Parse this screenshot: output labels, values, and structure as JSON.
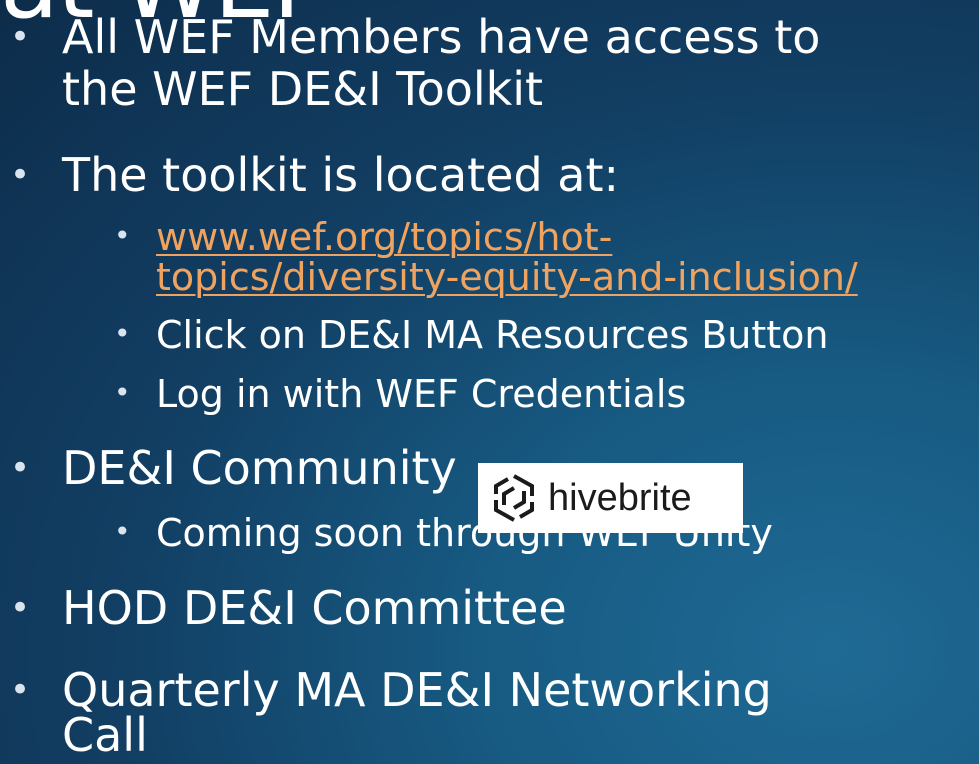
{
  "title_fragment": "at WEF",
  "bullets": [
    {
      "id": "members",
      "lines": [
        "All WEF Members have access to",
        "the WEF DE&I Toolkit"
      ]
    },
    {
      "id": "toolkit",
      "lines": [
        "The toolkit is located at:"
      ]
    },
    {
      "id": "community",
      "lines": [
        "DE&I Community"
      ]
    },
    {
      "id": "hod",
      "lines": [
        "HOD DE&I Committee"
      ]
    },
    {
      "id": "networking",
      "lines": [
        "Quarterly MA DE&I Networking",
        "Call"
      ]
    }
  ],
  "toolkit_subitems": {
    "link_line1": "www.wef.org/topics/hot-",
    "link_line2": "topics/diversity-equity-and-inclusion/",
    "click": "Click on DE&I MA Resources Button",
    "login": "Log in with WEF Credentials"
  },
  "community_subitems": {
    "coming_soon": "Coming soon through WEF Unity"
  },
  "logo": {
    "text": "hivebrite",
    "icon": "hivebrite-logo-icon"
  },
  "colors": {
    "link": "#f0a35e",
    "text": "#ffffff",
    "background_dark": "#0d2c4a",
    "background_light": "#1f6a95"
  }
}
